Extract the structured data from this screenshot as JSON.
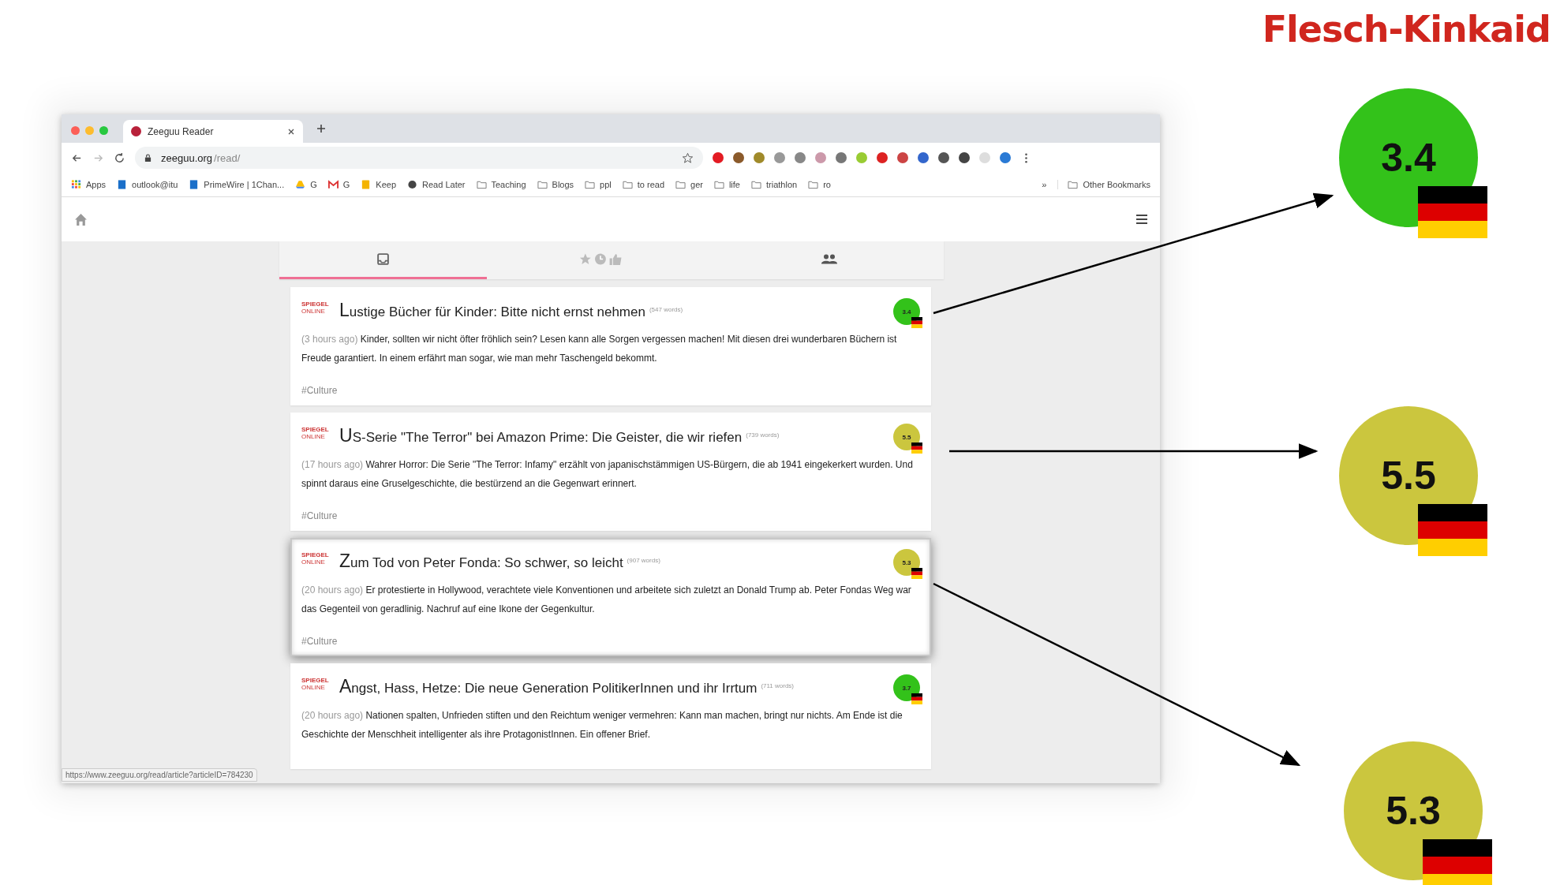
{
  "heading": "Flesch-Kinkaid",
  "browser": {
    "tab_title": "Zeeguu Reader",
    "url_host": "zeeguu.org",
    "url_path": "/read/",
    "bookmarks": [
      {
        "label": "Apps",
        "kind": "apps"
      },
      {
        "label": "outlook@itu",
        "kind": "site"
      },
      {
        "label": "PrimeWire | 1Chan...",
        "kind": "site"
      },
      {
        "label": "G",
        "kind": "drive"
      },
      {
        "label": "G",
        "kind": "mail"
      },
      {
        "label": "Keep",
        "kind": "keep"
      },
      {
        "label": "Read Later",
        "kind": "globe"
      },
      {
        "label": "Teaching",
        "kind": "folder"
      },
      {
        "label": "Blogs",
        "kind": "folder"
      },
      {
        "label": "ppl",
        "kind": "folder"
      },
      {
        "label": "to read",
        "kind": "folder"
      },
      {
        "label": "ger",
        "kind": "folder"
      },
      {
        "label": "life",
        "kind": "folder"
      },
      {
        "label": "triathlon",
        "kind": "folder"
      },
      {
        "label": "ro",
        "kind": "folder"
      }
    ],
    "overflow": "»",
    "other_bookmarks": "Other Bookmarks",
    "status_url": "https://www.zeeguu.org/read/article?articleID=784230"
  },
  "nav_tabs": [
    {
      "kind": "inbox",
      "selected": true
    },
    {
      "kind": "starred",
      "selected": false
    },
    {
      "kind": "people",
      "selected": false
    }
  ],
  "articles": [
    {
      "source": [
        "SPIEGEL",
        "ONLINE"
      ],
      "title": "Lustige Bücher für Kinder: Bitte nicht ernst nehmen",
      "words": "(547 words)",
      "time": "(3 hours ago)",
      "summary": "Kinder, sollten wir nicht öfter fröhlich sein? Lesen kann alle Sorgen vergessen machen! Mit diesen drei wunderbaren Büchern ist Freude garantiert. In einem erfährt man sogar, wie man mehr Taschengeld bekommt.",
      "tag": "#Culture",
      "score": "3.4",
      "color": "#33c21a",
      "highlighted": false
    },
    {
      "source": [
        "SPIEGEL",
        "ONLINE"
      ],
      "title": "US-Serie \"The Terror\" bei Amazon Prime: Die Geister, die wir riefen",
      "words": "(739 words)",
      "time": "(17 hours ago)",
      "summary": "Wahrer Horror: Die Serie \"The Terror: Infamy\" erzählt von japanischstämmigen US-Bürgern, die ab 1941 eingekerkert wurden. Und spinnt daraus eine Gruselgeschichte, die bestürzend an die Gegenwart erinnert.",
      "tag": "#Culture",
      "score": "5.5",
      "color": "#cbc63e",
      "highlighted": false
    },
    {
      "source": [
        "SPIEGEL",
        "ONLINE"
      ],
      "title": "Zum Tod von Peter Fonda: So schwer, so leicht",
      "words": "(907 words)",
      "time": "(20 hours ago)",
      "summary": "Er protestierte in Hollywood, verachtete viele Konventionen und arbeitete sich zuletzt an Donald Trump ab. Peter Fondas Weg war das Gegenteil von geradlinig. Nachruf auf eine Ikone der Gegenkultur.",
      "tag": "#Culture",
      "score": "5.3",
      "color": "#cbc63e",
      "highlighted": true
    },
    {
      "source": [
        "SPIEGEL",
        "ONLINE"
      ],
      "title": "Angst, Hass, Hetze: Die neue Generation PolitikerInnen und ihr Irrtum",
      "words": "(711 words)",
      "time": "(20 hours ago)",
      "summary": "Nationen spalten, Unfrieden stiften und den Reichtum weniger vermehren: Kann man machen, bringt nur nichts. Am Ende ist die Geschichte der Menschheit intelligenter als ihre ProtagonistInnen. Ein offener Brief.",
      "score": "3.7",
      "color": "#33c21a",
      "highlighted": false
    }
  ],
  "callouts": [
    {
      "score": "3.4",
      "color": "#33c21a"
    },
    {
      "score": "5.5",
      "color": "#cbc63e"
    },
    {
      "score": "5.3",
      "color": "#cbc63e"
    }
  ]
}
